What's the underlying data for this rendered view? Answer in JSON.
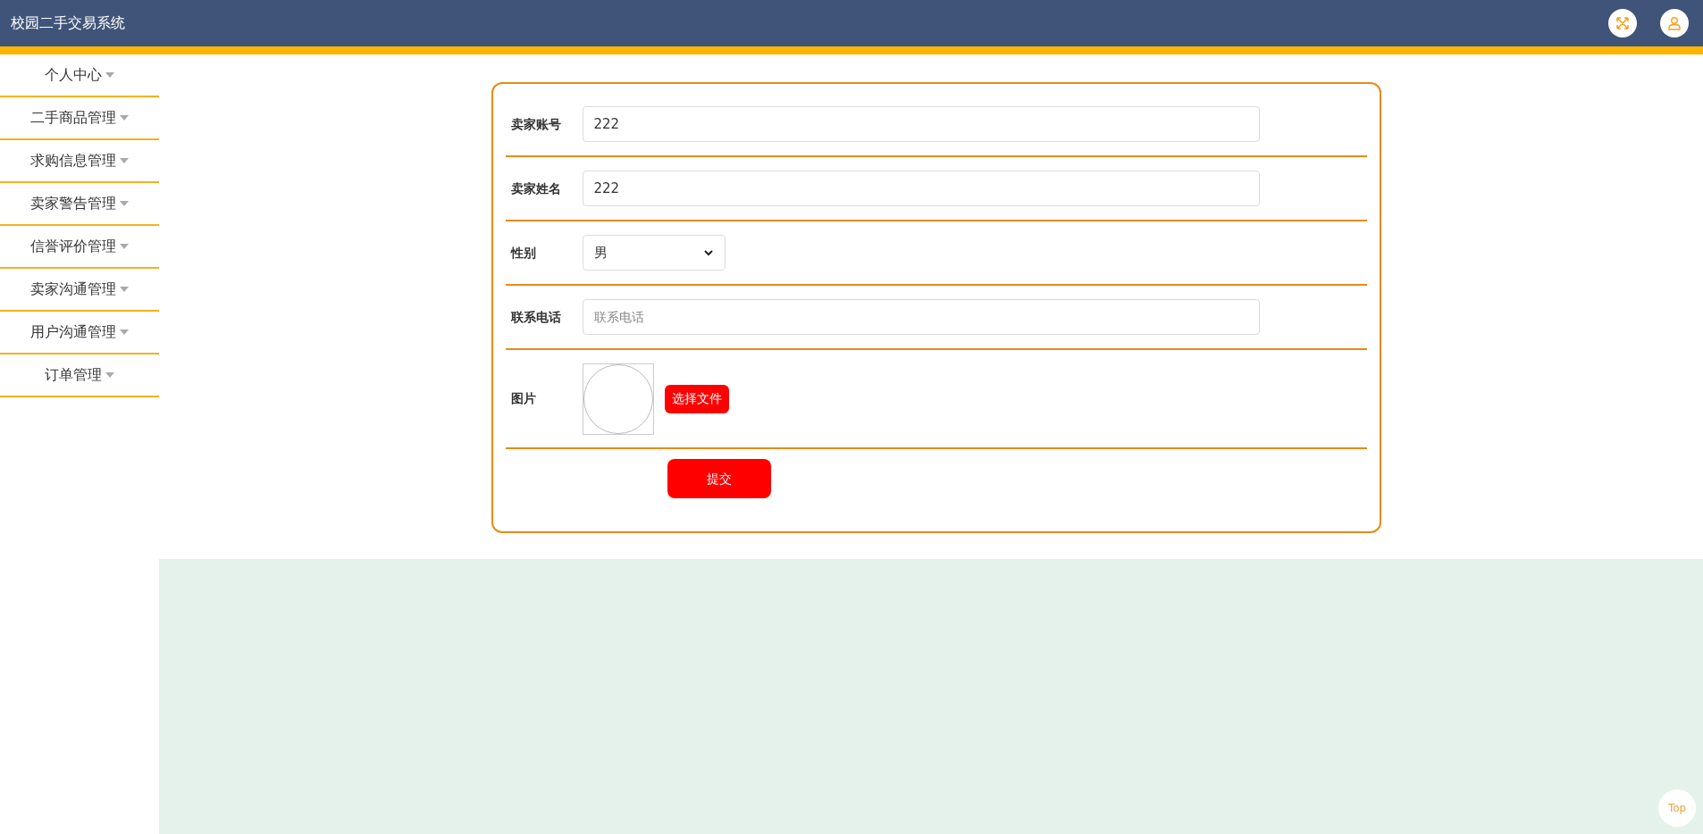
{
  "header": {
    "title": "校园二手交易系统"
  },
  "sidebar": {
    "items": [
      {
        "label": "个人中心"
      },
      {
        "label": "二手商品管理"
      },
      {
        "label": "求购信息管理"
      },
      {
        "label": "卖家警告管理"
      },
      {
        "label": "信誉评价管理"
      },
      {
        "label": "卖家沟通管理"
      },
      {
        "label": "用户沟通管理"
      },
      {
        "label": "订单管理"
      }
    ]
  },
  "form": {
    "fields": [
      {
        "kind": "text",
        "label": "卖家账号",
        "value": "222"
      },
      {
        "kind": "text",
        "label": "卖家姓名",
        "value": "222"
      },
      {
        "kind": "select",
        "label": "性别",
        "value": "男"
      },
      {
        "kind": "text",
        "label": "联系电话",
        "placeholder": "联系电话"
      },
      {
        "kind": "image",
        "label": "图片",
        "button": "选择文件"
      }
    ],
    "submit": "提交"
  },
  "back_to_top": "Top"
}
